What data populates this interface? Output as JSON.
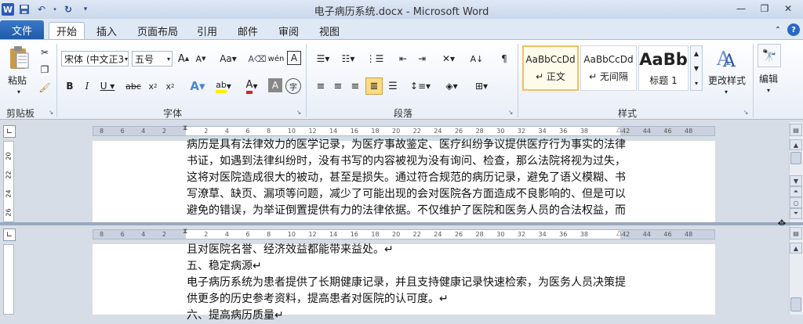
{
  "window": {
    "title": "电子病历系统.docx - Microsoft Word"
  },
  "qat": {
    "logo": "W"
  },
  "tabs": {
    "file": "文件",
    "home": "开始",
    "insert": "插入",
    "layout": "页面布局",
    "references": "引用",
    "mailings": "邮件",
    "review": "审阅",
    "view": "视图"
  },
  "ribbon": {
    "clipboard": {
      "label": "剪贴板",
      "paste": "粘贴"
    },
    "font": {
      "label": "字体",
      "name": "宋体 (中文正3",
      "size": "五号"
    },
    "paragraph": {
      "label": "段落"
    },
    "styles": {
      "label": "样式",
      "items": [
        {
          "preview": "AaBbCcDd",
          "name": "↵ 正文"
        },
        {
          "preview": "AaBbCcDd",
          "name": "↵ 无间隔"
        },
        {
          "preview": "AaBb",
          "name": "标题 1"
        }
      ],
      "change": "更改样式"
    },
    "editing": {
      "label": "编辑"
    }
  },
  "ruler": {
    "ticks": [
      "8",
      "6",
      "4",
      "2",
      "",
      "2",
      "4",
      "6",
      "8",
      "10",
      "12",
      "14",
      "16",
      "18",
      "20",
      "22",
      "24",
      "26",
      "28",
      "30",
      "32",
      "34",
      "36",
      "38",
      "",
      "42",
      "44",
      "46",
      "48"
    ]
  },
  "vruler_top": [
    "20",
    "22",
    "24",
    "26"
  ],
  "pane1": {
    "lines": [
      "病历是具有法律效力的医学记录，为医疗事故鉴定、医疗纠纷争议提供医疗行为事实的法律",
      "书证，如遇到法律纠纷时，没有书写的内容被视为没有询问、检查，那么法院将视为过失，",
      "这将对医院造成很大的被动，甚至是损失。通过符合规范的病历记录，避免了语义模糊、书",
      "写潦草、缺页、漏项等问题，减少了可能出现的会对医院各方面造成不良影响的、但是可以",
      "避免的错误，为举证倒置提供有力的法律依据。不仅维护了医院和医务人员的合法权益，而"
    ]
  },
  "pane2": {
    "lines": [
      "且对医院名誉、经济效益都能带来益处。↵",
      "五、稳定病源↵",
      "电子病历系统为患者提供了长期健康记录，并且支持健康记录快速检索，为医务人员决策提",
      "供更多的历史参考资料，提高患者对医院的认可度。↵",
      "六、提高病历质量↵"
    ]
  }
}
